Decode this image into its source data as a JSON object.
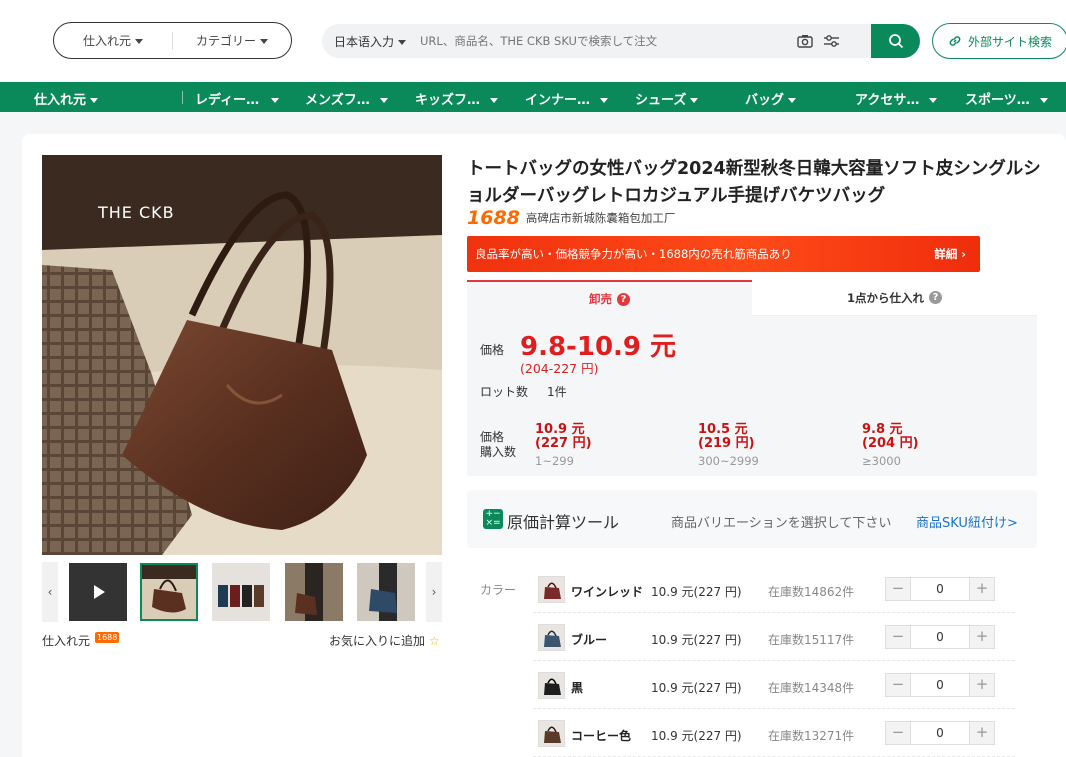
{
  "header": {
    "source_label": "仕入れ元",
    "category_label": "カテゴリー",
    "search_lang": "日本语入力",
    "search_placeholder": "URL、商品名、THE CKB SKUで検索して注文",
    "external_search": "外部サイト検索"
  },
  "nav": {
    "items": [
      "仕入れ元",
      "レディー…",
      "メンズフ…",
      "キッズフ…",
      "インナー…",
      "シューズ",
      "バッグ",
      "アクセサ…",
      "スポーツ…"
    ]
  },
  "product": {
    "title": "トートバッグの女性バッグ2024新型秋冬日韓大容量ソフト皮シングルショルダーバッグレトロカジュアル手提げバケツバッグ",
    "brand_watermark": "THE CKB",
    "platform_logo": "1688",
    "seller_name": "高碑店市新城陈囊箱包加工厂",
    "banner_text": "良品率が高い・価格競争力が高い・1688内の売れ筋商品あり",
    "banner_detail": "詳細",
    "source_text": "仕入れ元",
    "source_badge": "1688",
    "favorite_text": "お気に入りに追加"
  },
  "tabs": {
    "wholesale": "卸売",
    "single": "1点から仕入れ"
  },
  "pricing": {
    "price_label": "価格",
    "price_range": "9.8-10.9 元",
    "price_yen": "(204-227 円)",
    "lot_label": "ロット数",
    "lot_value": "1件",
    "tier_label_1": "価格",
    "tier_label_2": "購入数",
    "tiers": [
      {
        "price": "10.9 元",
        "yen": "(227 円)",
        "range": "1~299"
      },
      {
        "price": "10.5 元",
        "yen": "(219 円)",
        "range": "300~2999"
      },
      {
        "price": "9.8 元",
        "yen": "(204 円)",
        "range": "≥3000"
      }
    ]
  },
  "calc": {
    "title": "原価計算ツール",
    "hint": "商品バリエーションを選択して下さい",
    "link": "商品SKU紐付け>"
  },
  "sku": {
    "label": "カラー",
    "rows": [
      {
        "name": "ワインレッド",
        "price": "10.9 元(227 円)",
        "stock": "在庫数14862件",
        "qty": "0",
        "color": "#7a2a2a"
      },
      {
        "name": "ブルー",
        "price": "10.9 元(227 円)",
        "stock": "在庫数15117件",
        "qty": "0",
        "color": "#3c5670"
      },
      {
        "name": "黒",
        "price": "10.9 元(227 円)",
        "stock": "在庫数14348件",
        "qty": "0",
        "color": "#1e1e1e"
      },
      {
        "name": "コーヒー色",
        "price": "10.9 元(227 円)",
        "stock": "在庫数13271件",
        "qty": "0",
        "color": "#5a3a28"
      }
    ]
  },
  "colors": {
    "brand_green": "#0a8a5a",
    "price_red": "#e01e1e",
    "banner_red": "#f0320f",
    "link_blue": "#1a73c9"
  }
}
